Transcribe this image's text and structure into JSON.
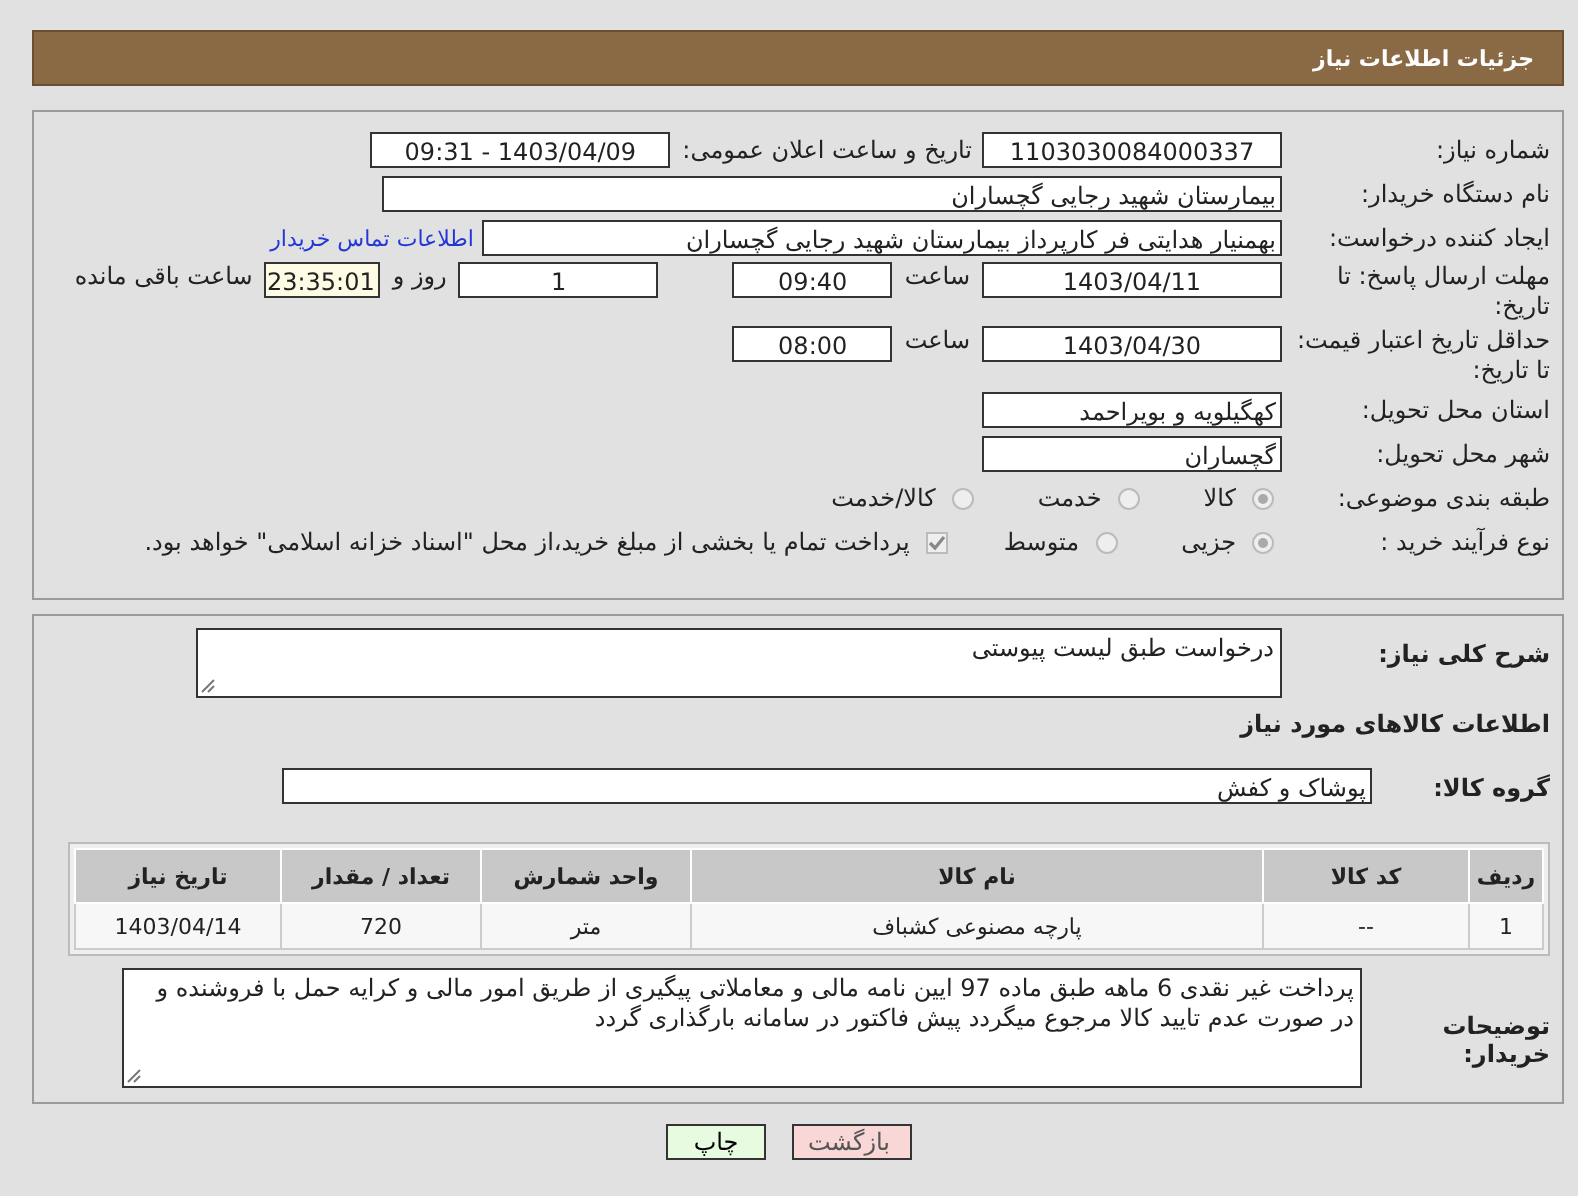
{
  "header": {
    "title": "جزئیات اطلاعات نیاز"
  },
  "need_number": {
    "label": "شماره نیاز:",
    "value": "1103030084000337"
  },
  "announce": {
    "label": "تاریخ و ساعت اعلان عمومی:",
    "value": "1403/04/09 - 09:31"
  },
  "buyer_org": {
    "label": "نام دستگاه خریدار:",
    "value": "بیمارستان شهید رجایی گچساران"
  },
  "creator": {
    "label": "ایجاد کننده درخواست:",
    "value": "بهمنیار هدایتی فر کارپرداز بیمارستان شهید رجایی گچساران",
    "link": "اطلاعات تماس خریدار"
  },
  "reply_deadline": {
    "label": "مهلت ارسال پاسخ: تا تاریخ:",
    "date": "1403/04/11",
    "time_label": "ساعت",
    "time": "09:40",
    "days": "1",
    "days_label": "روز و",
    "remaining": "23:35:01",
    "remaining_label": "ساعت باقی مانده"
  },
  "price_validity": {
    "label": "حداقل تاریخ اعتبار قیمت: تا تاریخ:",
    "date": "1403/04/30",
    "time_label": "ساعت",
    "time": "08:00"
  },
  "province": {
    "label": "استان محل تحویل:",
    "value": "کهگیلویه و بویراحمد"
  },
  "city": {
    "label": "شهر محل تحویل:",
    "value": "گچساران"
  },
  "category": {
    "label": "طبقه بندی موضوعی:",
    "disabled": true,
    "options": [
      {
        "label": "کالا",
        "selected": true
      },
      {
        "label": "خدمت",
        "selected": false
      },
      {
        "label": "کالا/خدمت",
        "selected": false
      }
    ]
  },
  "process": {
    "label": "نوع فرآیند خرید :",
    "disabled": true,
    "options": [
      {
        "label": "جزیی",
        "selected": true
      },
      {
        "label": "متوسط",
        "selected": false
      }
    ],
    "treasury": {
      "checked": true,
      "disabled": true,
      "text": "پرداخت تمام یا بخشی از مبلغ خرید،از محل \"اسناد خزانه اسلامی\" خواهد بود."
    }
  },
  "description": {
    "label": "شرح کلی نیاز:",
    "value": "درخواست طبق لیست پیوستی"
  },
  "goods_heading": "اطلاعات کالاهای مورد نیاز",
  "goods_group": {
    "label": "گروه کالا:",
    "value": "پوشاک و کفش"
  },
  "table": {
    "columns": [
      "ردیف",
      "کد کالا",
      "نام کالا",
      "واحد شمارش",
      "تعداد / مقدار",
      "تاریخ نیاز"
    ],
    "rows": [
      [
        "1",
        "--",
        "پارچه مصنوعی کشباف",
        "متر",
        "720",
        "1403/04/14"
      ]
    ]
  },
  "buyer_notes": {
    "label": "توضیحات خریدار:",
    "value": "پرداخت غیر نقدی 6 ماهه  طبق ماده 97 ایین نامه مالی و معاملاتی پیگیری از طریق امور مالی  و کرایه حمل با فروشنده و در صورت عدم تایید کالا مرجوع میگردد پیش فاکتور در سامانه بارگذاری گردد"
  },
  "buttons": [
    {
      "label": "بازگشت",
      "kind": "back"
    },
    {
      "label": "چاپ",
      "kind": "print"
    }
  ]
}
